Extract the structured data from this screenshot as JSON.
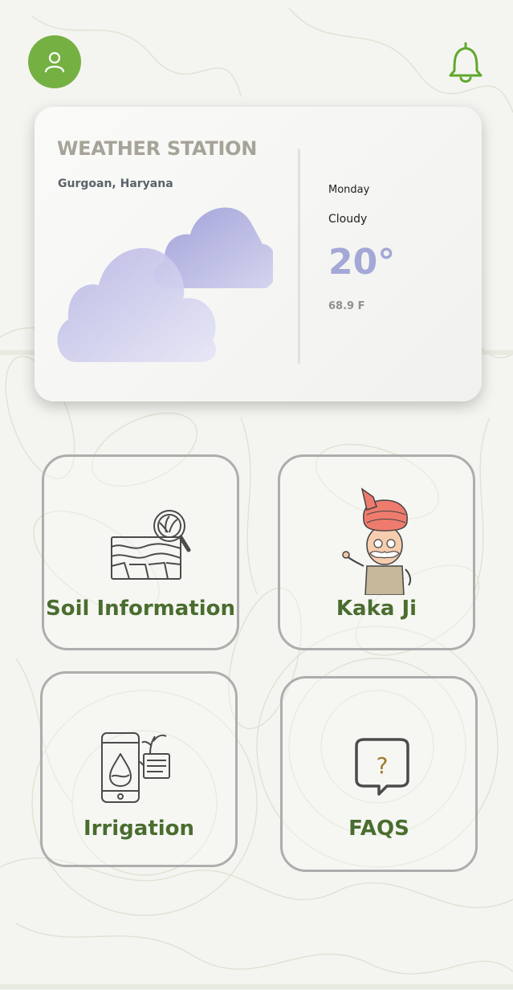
{
  "header": {
    "profile_icon": "user-icon",
    "notification_icon": "bell-icon",
    "accent_color": "#75b043"
  },
  "weather": {
    "title": "WEATHER STATION",
    "location": "Gurgoan, Haryana",
    "day": "Monday",
    "condition": "Cloudy",
    "temperature": "20°",
    "temperature_f": "68.9 F",
    "weather_icon": "cloud-icon"
  },
  "tiles": [
    {
      "label": "Soil Information",
      "icon": "soil-icon"
    },
    {
      "label": "Kaka Ji",
      "icon": "farmer-mascot-icon"
    },
    {
      "label": "Irrigation",
      "icon": "irrigation-phone-icon"
    },
    {
      "label": "FAQS",
      "icon": "question-chat-icon"
    }
  ],
  "colors": {
    "tile_label": "#4a6d2f",
    "temperature": "#a4a8d6",
    "background": "#f4f5f0"
  }
}
